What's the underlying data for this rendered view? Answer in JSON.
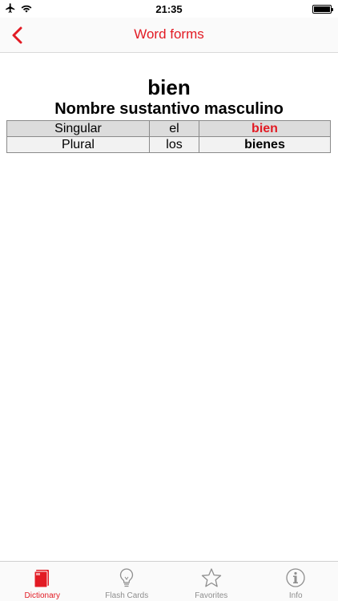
{
  "status_bar": {
    "time": "21:35"
  },
  "nav": {
    "title": "Word forms"
  },
  "entry": {
    "headword": "bien",
    "part_of_speech": "Nombre sustantivo masculino",
    "forms": [
      {
        "number": "Singular",
        "article": "el",
        "word": "bien",
        "highlight": true
      },
      {
        "number": "Plural",
        "article": "los",
        "word": "bienes",
        "highlight": false
      }
    ]
  },
  "tabs": [
    {
      "label": "Dictionary",
      "icon": "book-icon",
      "active": true
    },
    {
      "label": "Flash Cards",
      "icon": "lightbulb-icon",
      "active": false
    },
    {
      "label": "Favorites",
      "icon": "star-icon",
      "active": false
    },
    {
      "label": "Info",
      "icon": "info-icon",
      "active": false
    }
  ],
  "colors": {
    "accent": "#e21b24",
    "inactive": "#8e8e8e"
  }
}
